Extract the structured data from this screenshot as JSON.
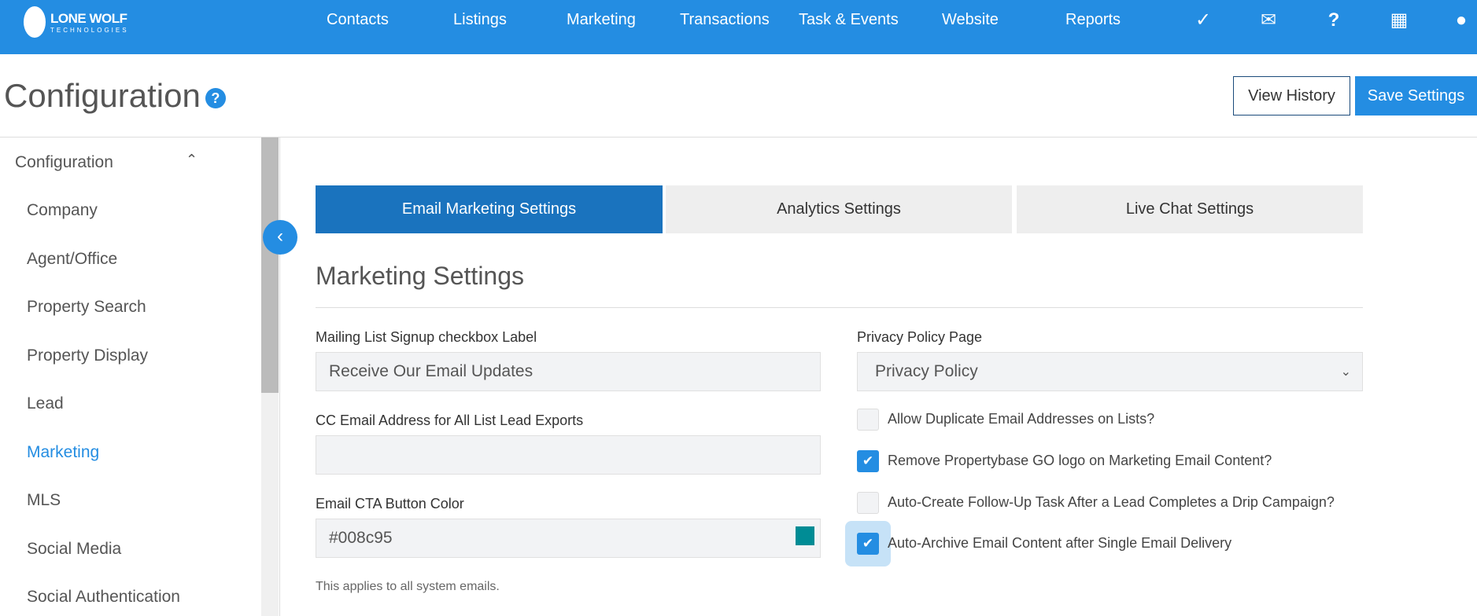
{
  "brand": {
    "name": "LONE WOLF",
    "sub": "TECHNOLOGIES"
  },
  "nav": [
    "Contacts",
    "Listings",
    "Marketing",
    "Transactions",
    "Task & Events",
    "Website",
    "Reports"
  ],
  "nav_icons": [
    "clipboard-check-icon",
    "envelope-icon",
    "help-icon",
    "grid-icon",
    "user-icon"
  ],
  "page": {
    "title": "Configuration",
    "help": "?",
    "view_history": "View History",
    "save": "Save Settings"
  },
  "sidebar": {
    "group": "Configuration",
    "items": [
      "Company",
      "Agent/Office",
      "Property Search",
      "Property Display",
      "Lead",
      "Marketing",
      "MLS",
      "Social Media",
      "Social Authentication"
    ],
    "active": "Marketing"
  },
  "tabs": [
    "Email Marketing Settings",
    "Analytics Settings",
    "Live Chat Settings"
  ],
  "section": "Marketing Settings",
  "form": {
    "signup_label": "Mailing List Signup checkbox Label",
    "signup_value": "Receive Our Email Updates",
    "cc_label": "CC Email Address for All List Lead Exports",
    "cc_value": "",
    "cta_label": "Email CTA Button Color",
    "cta_value": "#008c95",
    "note": "This applies to all system emails.",
    "privacy_label": "Privacy Policy Page",
    "privacy_value": "Privacy Policy",
    "checks": [
      {
        "label": "Allow Duplicate Email Addresses on Lists?",
        "checked": false
      },
      {
        "label": "Remove Propertybase GO logo on Marketing Email Content?",
        "checked": true
      },
      {
        "label": "Auto-Create Follow-Up Task After a Lead Completes a Drip Campaign?",
        "checked": false
      },
      {
        "label": "Auto-Archive Email Content after Single Email Delivery",
        "checked": true
      }
    ]
  },
  "colors": {
    "primary": "#248de2",
    "tab_active": "#1a73be",
    "cta": "#008c95"
  }
}
